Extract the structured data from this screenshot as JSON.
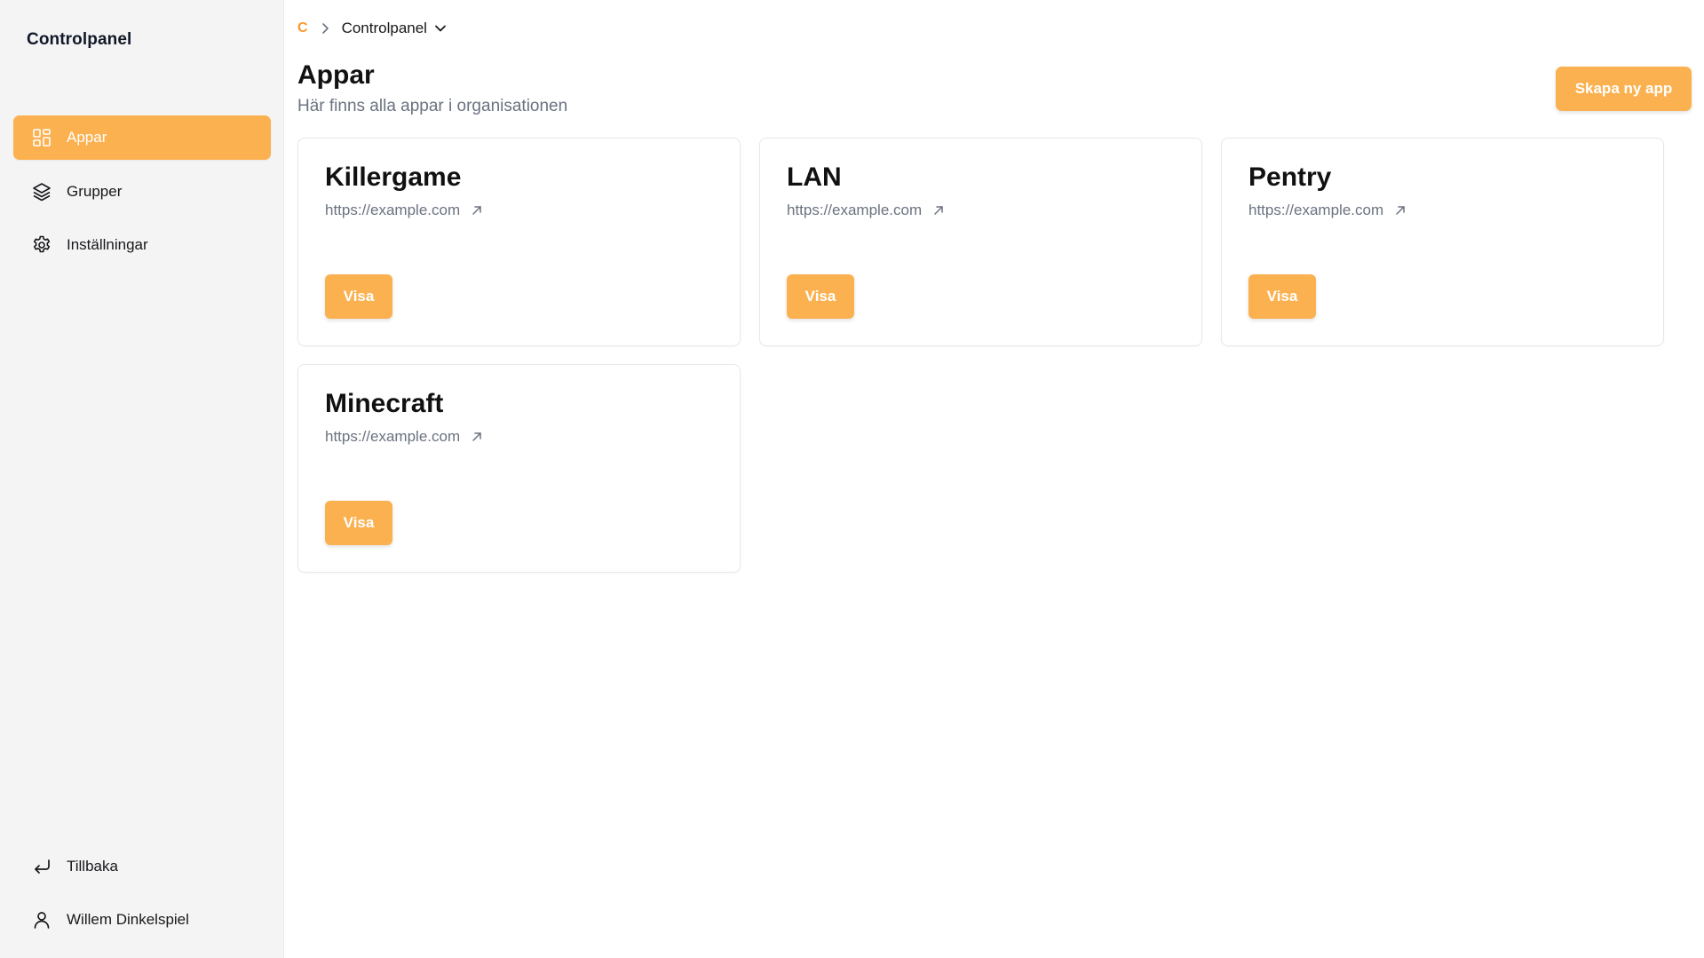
{
  "sidebar": {
    "brand": "Controlpanel",
    "items": [
      {
        "label": "Appar",
        "icon": "grid-icon",
        "active": true
      },
      {
        "label": "Grupper",
        "icon": "layers-icon",
        "active": false
      },
      {
        "label": "Inställningar",
        "icon": "gear-icon",
        "active": false
      }
    ],
    "bottom_items": [
      {
        "label": "Tillbaka",
        "icon": "return-arrow-icon"
      },
      {
        "label": "Willem Dinkelspiel",
        "icon": "user-icon"
      }
    ]
  },
  "breadcrumb": {
    "home": "C",
    "current": "Controlpanel"
  },
  "header": {
    "title": "Appar",
    "subtitle": "Här finns alla appar i organisationen",
    "create_button": "Skapa ny app"
  },
  "apps": [
    {
      "name": "Killergame",
      "url": "https://example.com",
      "button": "Visa"
    },
    {
      "name": "LAN",
      "url": "https://example.com",
      "button": "Visa"
    },
    {
      "name": "Pentry",
      "url": "https://example.com",
      "button": "Visa"
    },
    {
      "name": "Minecraft",
      "url": "https://example.com",
      "button": "Visa"
    }
  ],
  "colors": {
    "accent": "#fbb150",
    "sidebar_bg": "#f4f4f5",
    "muted_text": "#6b7280"
  }
}
